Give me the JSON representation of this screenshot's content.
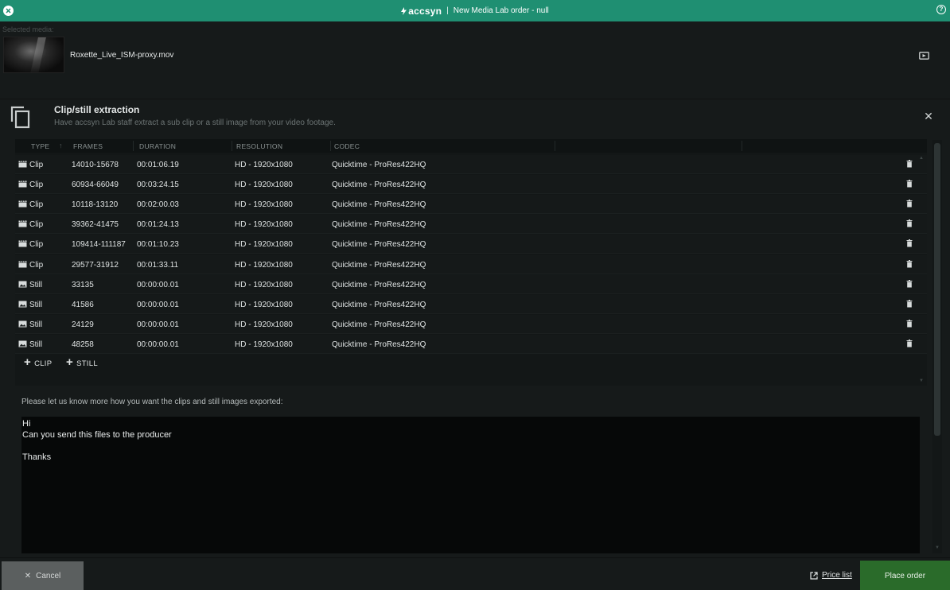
{
  "titlebar": {
    "app_name": "accsyn",
    "separator": "|",
    "title": "New Media Lab order - null",
    "help_glyph": "?",
    "bg_color": "#1f8f72"
  },
  "media": {
    "label": "Selected media:",
    "filename": "Roxette_Live_ISM-proxy.mov"
  },
  "section": {
    "title": "Clip/still extraction",
    "subtitle": "Have accsyn Lab staff extract a sub clip or a still image from your video footage.",
    "close_glyph": "✕"
  },
  "table": {
    "headers": [
      "TYPE",
      "FRAMES",
      "DURATION",
      "RESOLUTION",
      "CODEC"
    ],
    "sort_glyph": "↑",
    "rows": [
      {
        "type": "Clip",
        "icon": "clapper-icon",
        "frames": "14010-15678",
        "duration": "00:01:06.19",
        "resolution": "HD - 1920x1080",
        "codec": "Quicktime - ProRes422HQ"
      },
      {
        "type": "Clip",
        "icon": "clapper-icon",
        "frames": "60934-66049",
        "duration": "00:03:24.15",
        "resolution": "HD - 1920x1080",
        "codec": "Quicktime - ProRes422HQ"
      },
      {
        "type": "Clip",
        "icon": "clapper-icon",
        "frames": "10118-13120",
        "duration": "00:02:00.03",
        "resolution": "HD - 1920x1080",
        "codec": "Quicktime - ProRes422HQ"
      },
      {
        "type": "Clip",
        "icon": "clapper-icon",
        "frames": "39362-41475",
        "duration": "00:01:24.13",
        "resolution": "HD - 1920x1080",
        "codec": "Quicktime - ProRes422HQ"
      },
      {
        "type": "Clip",
        "icon": "clapper-icon",
        "frames": "109414-111187",
        "duration": "00:01:10.23",
        "resolution": "HD - 1920x1080",
        "codec": "Quicktime - ProRes422HQ"
      },
      {
        "type": "Clip",
        "icon": "clapper-icon",
        "frames": "29577-31912",
        "duration": "00:01:33.11",
        "resolution": "HD - 1920x1080",
        "codec": "Quicktime - ProRes422HQ"
      },
      {
        "type": "Still",
        "icon": "image-icon",
        "frames": "33135",
        "duration": "00:00:00.01",
        "resolution": "HD - 1920x1080",
        "codec": "Quicktime - ProRes422HQ"
      },
      {
        "type": "Still",
        "icon": "image-icon",
        "frames": "41586",
        "duration": "00:00:00.01",
        "resolution": "HD - 1920x1080",
        "codec": "Quicktime - ProRes422HQ"
      },
      {
        "type": "Still",
        "icon": "image-icon",
        "frames": "24129",
        "duration": "00:00:00.01",
        "resolution": "HD - 1920x1080",
        "codec": "Quicktime - ProRes422HQ"
      },
      {
        "type": "Still",
        "icon": "image-icon",
        "frames": "48258",
        "duration": "00:00:00.01",
        "resolution": "HD - 1920x1080",
        "codec": "Quicktime - ProRes422HQ"
      }
    ],
    "add_clip_label": "CLIP",
    "add_still_label": "STILL",
    "plus_glyph": "+"
  },
  "notes": {
    "label": "Please let us know more how you want the clips and still images exported:",
    "lines": [
      "Hi",
      "Can you send this files to the producer",
      "",
      "Thanks"
    ]
  },
  "footer": {
    "cancel_label": "Cancel",
    "cancel_glyph": "✕",
    "price_list_label": "Price list",
    "place_order_label": "Place order",
    "place_order_color": "#2a6b2a"
  }
}
